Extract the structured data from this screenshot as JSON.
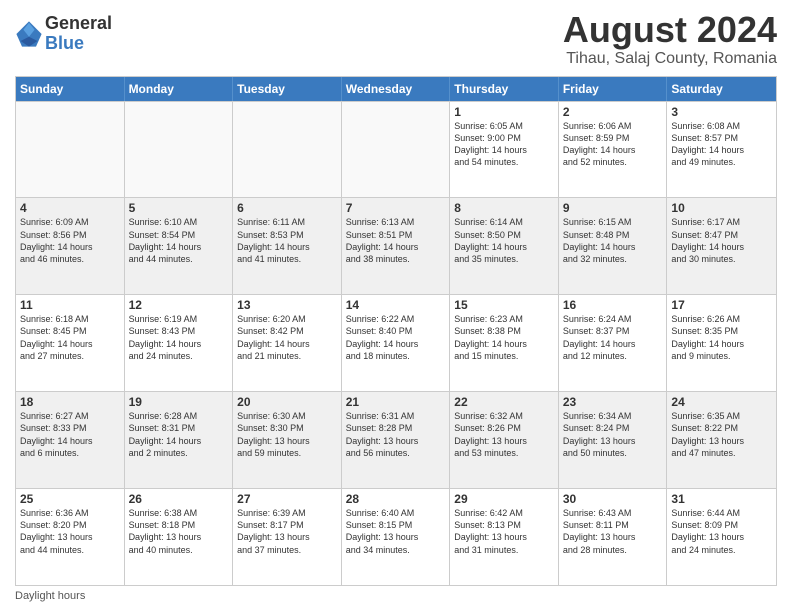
{
  "logo": {
    "general": "General",
    "blue": "Blue"
  },
  "title": "August 2024",
  "subtitle": "Tihau, Salaj County, Romania",
  "days": [
    "Sunday",
    "Monday",
    "Tuesday",
    "Wednesday",
    "Thursday",
    "Friday",
    "Saturday"
  ],
  "footer": "Daylight hours",
  "weeks": [
    [
      {
        "day": "",
        "content": ""
      },
      {
        "day": "",
        "content": ""
      },
      {
        "day": "",
        "content": ""
      },
      {
        "day": "",
        "content": ""
      },
      {
        "day": "1",
        "content": "Sunrise: 6:05 AM\nSunset: 9:00 PM\nDaylight: 14 hours\nand 54 minutes."
      },
      {
        "day": "2",
        "content": "Sunrise: 6:06 AM\nSunset: 8:59 PM\nDaylight: 14 hours\nand 52 minutes."
      },
      {
        "day": "3",
        "content": "Sunrise: 6:08 AM\nSunset: 8:57 PM\nDaylight: 14 hours\nand 49 minutes."
      }
    ],
    [
      {
        "day": "4",
        "content": "Sunrise: 6:09 AM\nSunset: 8:56 PM\nDaylight: 14 hours\nand 46 minutes."
      },
      {
        "day": "5",
        "content": "Sunrise: 6:10 AM\nSunset: 8:54 PM\nDaylight: 14 hours\nand 44 minutes."
      },
      {
        "day": "6",
        "content": "Sunrise: 6:11 AM\nSunset: 8:53 PM\nDaylight: 14 hours\nand 41 minutes."
      },
      {
        "day": "7",
        "content": "Sunrise: 6:13 AM\nSunset: 8:51 PM\nDaylight: 14 hours\nand 38 minutes."
      },
      {
        "day": "8",
        "content": "Sunrise: 6:14 AM\nSunset: 8:50 PM\nDaylight: 14 hours\nand 35 minutes."
      },
      {
        "day": "9",
        "content": "Sunrise: 6:15 AM\nSunset: 8:48 PM\nDaylight: 14 hours\nand 32 minutes."
      },
      {
        "day": "10",
        "content": "Sunrise: 6:17 AM\nSunset: 8:47 PM\nDaylight: 14 hours\nand 30 minutes."
      }
    ],
    [
      {
        "day": "11",
        "content": "Sunrise: 6:18 AM\nSunset: 8:45 PM\nDaylight: 14 hours\nand 27 minutes."
      },
      {
        "day": "12",
        "content": "Sunrise: 6:19 AM\nSunset: 8:43 PM\nDaylight: 14 hours\nand 24 minutes."
      },
      {
        "day": "13",
        "content": "Sunrise: 6:20 AM\nSunset: 8:42 PM\nDaylight: 14 hours\nand 21 minutes."
      },
      {
        "day": "14",
        "content": "Sunrise: 6:22 AM\nSunset: 8:40 PM\nDaylight: 14 hours\nand 18 minutes."
      },
      {
        "day": "15",
        "content": "Sunrise: 6:23 AM\nSunset: 8:38 PM\nDaylight: 14 hours\nand 15 minutes."
      },
      {
        "day": "16",
        "content": "Sunrise: 6:24 AM\nSunset: 8:37 PM\nDaylight: 14 hours\nand 12 minutes."
      },
      {
        "day": "17",
        "content": "Sunrise: 6:26 AM\nSunset: 8:35 PM\nDaylight: 14 hours\nand 9 minutes."
      }
    ],
    [
      {
        "day": "18",
        "content": "Sunrise: 6:27 AM\nSunset: 8:33 PM\nDaylight: 14 hours\nand 6 minutes."
      },
      {
        "day": "19",
        "content": "Sunrise: 6:28 AM\nSunset: 8:31 PM\nDaylight: 14 hours\nand 2 minutes."
      },
      {
        "day": "20",
        "content": "Sunrise: 6:30 AM\nSunset: 8:30 PM\nDaylight: 13 hours\nand 59 minutes."
      },
      {
        "day": "21",
        "content": "Sunrise: 6:31 AM\nSunset: 8:28 PM\nDaylight: 13 hours\nand 56 minutes."
      },
      {
        "day": "22",
        "content": "Sunrise: 6:32 AM\nSunset: 8:26 PM\nDaylight: 13 hours\nand 53 minutes."
      },
      {
        "day": "23",
        "content": "Sunrise: 6:34 AM\nSunset: 8:24 PM\nDaylight: 13 hours\nand 50 minutes."
      },
      {
        "day": "24",
        "content": "Sunrise: 6:35 AM\nSunset: 8:22 PM\nDaylight: 13 hours\nand 47 minutes."
      }
    ],
    [
      {
        "day": "25",
        "content": "Sunrise: 6:36 AM\nSunset: 8:20 PM\nDaylight: 13 hours\nand 44 minutes."
      },
      {
        "day": "26",
        "content": "Sunrise: 6:38 AM\nSunset: 8:18 PM\nDaylight: 13 hours\nand 40 minutes."
      },
      {
        "day": "27",
        "content": "Sunrise: 6:39 AM\nSunset: 8:17 PM\nDaylight: 13 hours\nand 37 minutes."
      },
      {
        "day": "28",
        "content": "Sunrise: 6:40 AM\nSunset: 8:15 PM\nDaylight: 13 hours\nand 34 minutes."
      },
      {
        "day": "29",
        "content": "Sunrise: 6:42 AM\nSunset: 8:13 PM\nDaylight: 13 hours\nand 31 minutes."
      },
      {
        "day": "30",
        "content": "Sunrise: 6:43 AM\nSunset: 8:11 PM\nDaylight: 13 hours\nand 28 minutes."
      },
      {
        "day": "31",
        "content": "Sunrise: 6:44 AM\nSunset: 8:09 PM\nDaylight: 13 hours\nand 24 minutes."
      }
    ]
  ]
}
